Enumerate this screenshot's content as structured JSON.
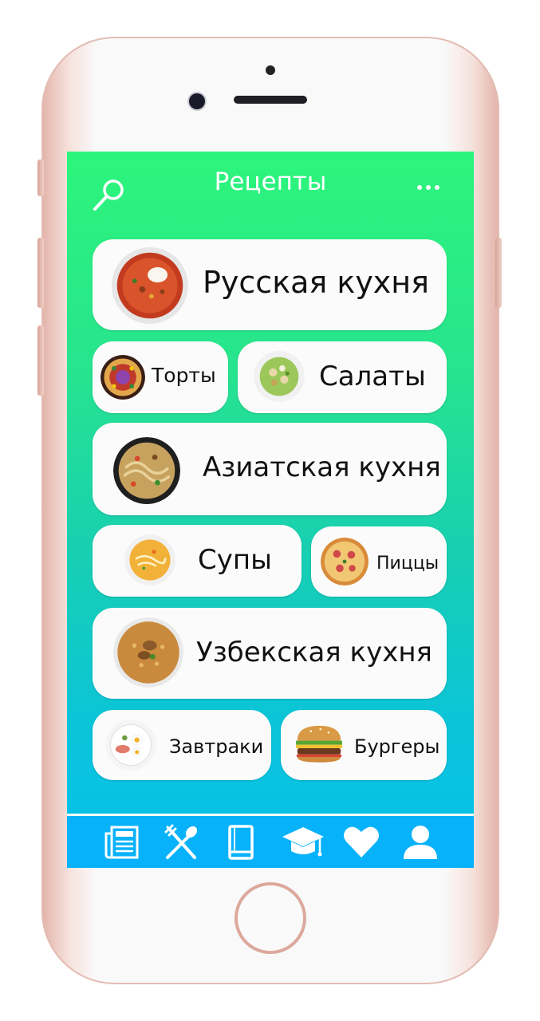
{
  "header": {
    "title": "Рецепты"
  },
  "categories": [
    {
      "id": "russian",
      "label": "Русская кухня"
    },
    {
      "id": "cakes",
      "label": "Торты"
    },
    {
      "id": "salads",
      "label": "Салаты"
    },
    {
      "id": "asian",
      "label": "Азиатская кухня"
    },
    {
      "id": "soups",
      "label": "Супы"
    },
    {
      "id": "pizza",
      "label": "Пиццы"
    },
    {
      "id": "uzbek",
      "label": "Узбекская кухня"
    },
    {
      "id": "breakfast",
      "label": "Завтраки"
    },
    {
      "id": "burgers",
      "label": "Бургеры"
    }
  ],
  "icons": {
    "search": "search-icon",
    "more": "more-icon",
    "nav": [
      "newspaper-icon",
      "fork-spoon-icon",
      "book-icon",
      "graduation-cap-icon",
      "heart-icon",
      "user-icon"
    ]
  },
  "colors": {
    "gradient_top": "#2df57b",
    "gradient_bottom": "#06c1ee",
    "navbar": "#08b2fa",
    "card": "#fbfbfb",
    "text": "#111111"
  }
}
